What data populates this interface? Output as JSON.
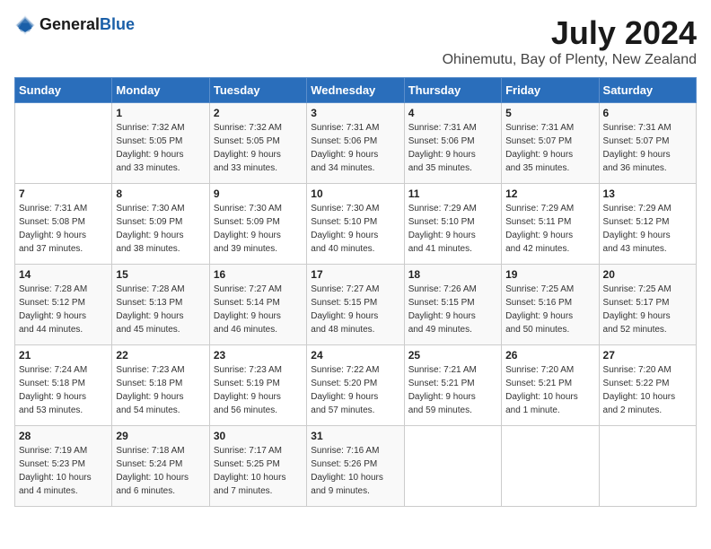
{
  "header": {
    "logo_general": "General",
    "logo_blue": "Blue",
    "month_year": "July 2024",
    "location": "Ohinemutu, Bay of Plenty, New Zealand"
  },
  "weekdays": [
    "Sunday",
    "Monday",
    "Tuesday",
    "Wednesday",
    "Thursday",
    "Friday",
    "Saturday"
  ],
  "weeks": [
    [
      {
        "day": "",
        "content": ""
      },
      {
        "day": "1",
        "content": "Sunrise: 7:32 AM\nSunset: 5:05 PM\nDaylight: 9 hours\nand 33 minutes."
      },
      {
        "day": "2",
        "content": "Sunrise: 7:32 AM\nSunset: 5:05 PM\nDaylight: 9 hours\nand 33 minutes."
      },
      {
        "day": "3",
        "content": "Sunrise: 7:31 AM\nSunset: 5:06 PM\nDaylight: 9 hours\nand 34 minutes."
      },
      {
        "day": "4",
        "content": "Sunrise: 7:31 AM\nSunset: 5:06 PM\nDaylight: 9 hours\nand 35 minutes."
      },
      {
        "day": "5",
        "content": "Sunrise: 7:31 AM\nSunset: 5:07 PM\nDaylight: 9 hours\nand 35 minutes."
      },
      {
        "day": "6",
        "content": "Sunrise: 7:31 AM\nSunset: 5:07 PM\nDaylight: 9 hours\nand 36 minutes."
      }
    ],
    [
      {
        "day": "7",
        "content": "Sunrise: 7:31 AM\nSunset: 5:08 PM\nDaylight: 9 hours\nand 37 minutes."
      },
      {
        "day": "8",
        "content": "Sunrise: 7:30 AM\nSunset: 5:09 PM\nDaylight: 9 hours\nand 38 minutes."
      },
      {
        "day": "9",
        "content": "Sunrise: 7:30 AM\nSunset: 5:09 PM\nDaylight: 9 hours\nand 39 minutes."
      },
      {
        "day": "10",
        "content": "Sunrise: 7:30 AM\nSunset: 5:10 PM\nDaylight: 9 hours\nand 40 minutes."
      },
      {
        "day": "11",
        "content": "Sunrise: 7:29 AM\nSunset: 5:10 PM\nDaylight: 9 hours\nand 41 minutes."
      },
      {
        "day": "12",
        "content": "Sunrise: 7:29 AM\nSunset: 5:11 PM\nDaylight: 9 hours\nand 42 minutes."
      },
      {
        "day": "13",
        "content": "Sunrise: 7:29 AM\nSunset: 5:12 PM\nDaylight: 9 hours\nand 43 minutes."
      }
    ],
    [
      {
        "day": "14",
        "content": "Sunrise: 7:28 AM\nSunset: 5:12 PM\nDaylight: 9 hours\nand 44 minutes."
      },
      {
        "day": "15",
        "content": "Sunrise: 7:28 AM\nSunset: 5:13 PM\nDaylight: 9 hours\nand 45 minutes."
      },
      {
        "day": "16",
        "content": "Sunrise: 7:27 AM\nSunset: 5:14 PM\nDaylight: 9 hours\nand 46 minutes."
      },
      {
        "day": "17",
        "content": "Sunrise: 7:27 AM\nSunset: 5:15 PM\nDaylight: 9 hours\nand 48 minutes."
      },
      {
        "day": "18",
        "content": "Sunrise: 7:26 AM\nSunset: 5:15 PM\nDaylight: 9 hours\nand 49 minutes."
      },
      {
        "day": "19",
        "content": "Sunrise: 7:25 AM\nSunset: 5:16 PM\nDaylight: 9 hours\nand 50 minutes."
      },
      {
        "day": "20",
        "content": "Sunrise: 7:25 AM\nSunset: 5:17 PM\nDaylight: 9 hours\nand 52 minutes."
      }
    ],
    [
      {
        "day": "21",
        "content": "Sunrise: 7:24 AM\nSunset: 5:18 PM\nDaylight: 9 hours\nand 53 minutes."
      },
      {
        "day": "22",
        "content": "Sunrise: 7:23 AM\nSunset: 5:18 PM\nDaylight: 9 hours\nand 54 minutes."
      },
      {
        "day": "23",
        "content": "Sunrise: 7:23 AM\nSunset: 5:19 PM\nDaylight: 9 hours\nand 56 minutes."
      },
      {
        "day": "24",
        "content": "Sunrise: 7:22 AM\nSunset: 5:20 PM\nDaylight: 9 hours\nand 57 minutes."
      },
      {
        "day": "25",
        "content": "Sunrise: 7:21 AM\nSunset: 5:21 PM\nDaylight: 9 hours\nand 59 minutes."
      },
      {
        "day": "26",
        "content": "Sunrise: 7:20 AM\nSunset: 5:21 PM\nDaylight: 10 hours\nand 1 minute."
      },
      {
        "day": "27",
        "content": "Sunrise: 7:20 AM\nSunset: 5:22 PM\nDaylight: 10 hours\nand 2 minutes."
      }
    ],
    [
      {
        "day": "28",
        "content": "Sunrise: 7:19 AM\nSunset: 5:23 PM\nDaylight: 10 hours\nand 4 minutes."
      },
      {
        "day": "29",
        "content": "Sunrise: 7:18 AM\nSunset: 5:24 PM\nDaylight: 10 hours\nand 6 minutes."
      },
      {
        "day": "30",
        "content": "Sunrise: 7:17 AM\nSunset: 5:25 PM\nDaylight: 10 hours\nand 7 minutes."
      },
      {
        "day": "31",
        "content": "Sunrise: 7:16 AM\nSunset: 5:26 PM\nDaylight: 10 hours\nand 9 minutes."
      },
      {
        "day": "",
        "content": ""
      },
      {
        "day": "",
        "content": ""
      },
      {
        "day": "",
        "content": ""
      }
    ]
  ]
}
